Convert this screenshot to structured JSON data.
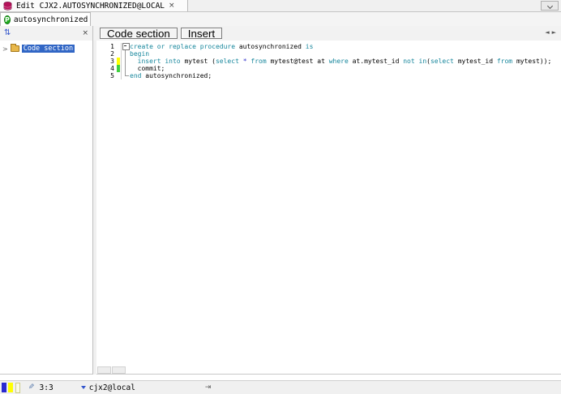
{
  "colors": {
    "keyword": "#16869c",
    "operator": "#3333cc",
    "plain": "#000000",
    "selection": "#3166c5",
    "marker_yellow": "#ffff00",
    "marker_green": "#3fd03f",
    "status_blue": "#2a2ad0",
    "status_yellow": "#ffff00"
  },
  "titlebar": {
    "tab_title": "Edit CJX2.AUTOSYNCHRONIZED@LOCAL",
    "close_label": "×",
    "tab_list_icon": "chevron-down"
  },
  "object_tabbar": {
    "tabs": [
      {
        "label": "autosynchronized",
        "icon": "procedure-icon"
      }
    ]
  },
  "left_panel": {
    "sort_icon": "⇅",
    "close_label": "×",
    "tree": [
      {
        "label": "Code section",
        "selected": true,
        "expander": ">"
      }
    ]
  },
  "section_toolbar": {
    "buttons": [
      {
        "label": "Code section"
      },
      {
        "label": "Insert"
      }
    ],
    "scroll_left": "◄",
    "scroll_right": "►"
  },
  "editor": {
    "lines": [
      {
        "num": "1",
        "fold": "box",
        "marker": "",
        "tokens": [
          [
            "k",
            "create or replace procedure"
          ],
          [
            "p",
            " autosynchronized "
          ],
          [
            "k",
            "is"
          ]
        ]
      },
      {
        "num": "2",
        "fold": "line",
        "marker": "",
        "tokens": [
          [
            "k",
            "begin"
          ]
        ]
      },
      {
        "num": "3",
        "fold": "line",
        "marker": "yellow",
        "tokens": [
          [
            "p",
            "  "
          ],
          [
            "k",
            "insert into"
          ],
          [
            "p",
            " mytest ("
          ],
          [
            "k",
            "select"
          ],
          [
            "p",
            " "
          ],
          [
            "o",
            "*"
          ],
          [
            "p",
            " "
          ],
          [
            "k",
            "from"
          ],
          [
            "p",
            " mytest@test at "
          ],
          [
            "k",
            "where"
          ],
          [
            "p",
            " at.mytest_id "
          ],
          [
            "k",
            "not in"
          ],
          [
            "p",
            "("
          ],
          [
            "k",
            "select"
          ],
          [
            "p",
            " mytest_id "
          ],
          [
            "k",
            "from"
          ],
          [
            "p",
            " mytest));"
          ]
        ]
      },
      {
        "num": "4",
        "fold": "line",
        "marker": "green",
        "tokens": [
          [
            "p",
            "  commit;"
          ]
        ]
      },
      {
        "num": "5",
        "fold": "end",
        "marker": "",
        "tokens": [
          [
            "k",
            "end"
          ],
          [
            "p",
            " autosynchronized;"
          ]
        ]
      }
    ]
  },
  "status_bar": {
    "cursor_position": "3:3",
    "connection": "cjx2@local",
    "edit_icon": "✎",
    "tab_stop_icon": "⇥"
  }
}
